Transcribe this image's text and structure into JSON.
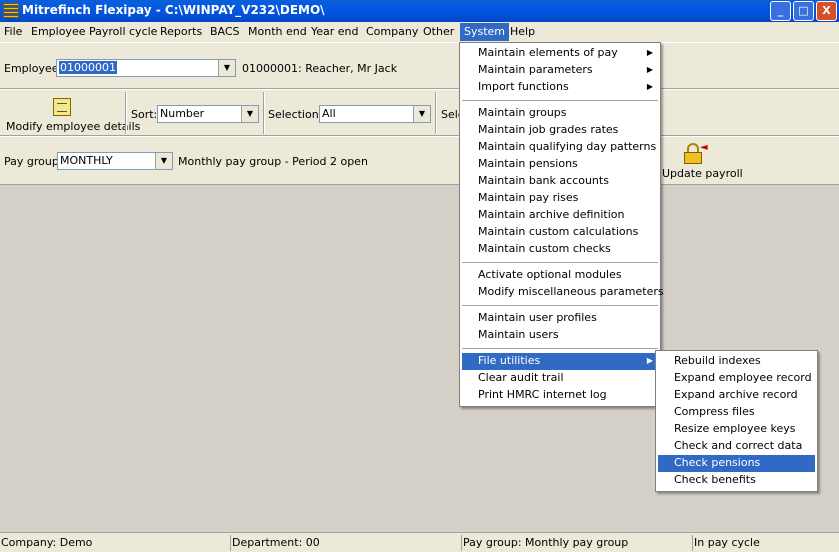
{
  "window": {
    "title": "Mitrefinch Flexipay - C:\\WINPAY_V232\\DEMO\\",
    "min_label": "_",
    "max_label": "□",
    "close_label": "X"
  },
  "menubar": {
    "file": "File",
    "employee": "Employee",
    "payroll_cycle": "Payroll cycle",
    "reports": "Reports",
    "bacs": "BACS",
    "month_end": "Month end",
    "year_end": "Year end",
    "company": "Company",
    "other": "Other",
    "system": "System",
    "help": "Help"
  },
  "employee_bar": {
    "label": "Employee:",
    "value": "01000001",
    "description": "01000001: Reacher, Mr Jack"
  },
  "toolbar": {
    "modify_label": "Modify employee details",
    "sort_label": "Sort:",
    "sort_value": "Number",
    "selection_label": "Selection:",
    "selection_value": "All",
    "cut_label": "Sele"
  },
  "paygroup_bar": {
    "label": "Pay group:",
    "value": "MONTHLY",
    "description": "Monthly pay group - Period 2 open",
    "update_label": "Update payroll"
  },
  "system_menu": {
    "items": [
      "Maintain elements of pay",
      "Maintain parameters",
      "Import functions",
      "Maintain groups",
      "Maintain job grades rates",
      "Maintain qualifying day patterns",
      "Maintain pensions",
      "Maintain bank accounts",
      "Maintain pay rises",
      "Maintain archive definition",
      "Maintain custom calculations",
      "Maintain custom checks",
      "Activate optional modules",
      "Modify miscellaneous parameters",
      "Maintain user profiles",
      "Maintain users",
      "File utilities",
      "Clear audit trail",
      "Print HMRC internet log"
    ]
  },
  "file_utilities_menu": {
    "items": [
      "Rebuild indexes",
      "Expand employee record",
      "Expand archive record",
      "Compress files",
      "Resize employee keys",
      "Check and correct data",
      "Check pensions",
      "Check benefits"
    ]
  },
  "statusbar": {
    "company": "Company: Demo",
    "department": "Department: 00",
    "pay_group": "Pay group: Monthly pay group",
    "state": "In pay cycle"
  },
  "colors": {
    "titlebar": "#0458e4",
    "highlight": "#316ac5",
    "menubar": "#ece9d8"
  }
}
